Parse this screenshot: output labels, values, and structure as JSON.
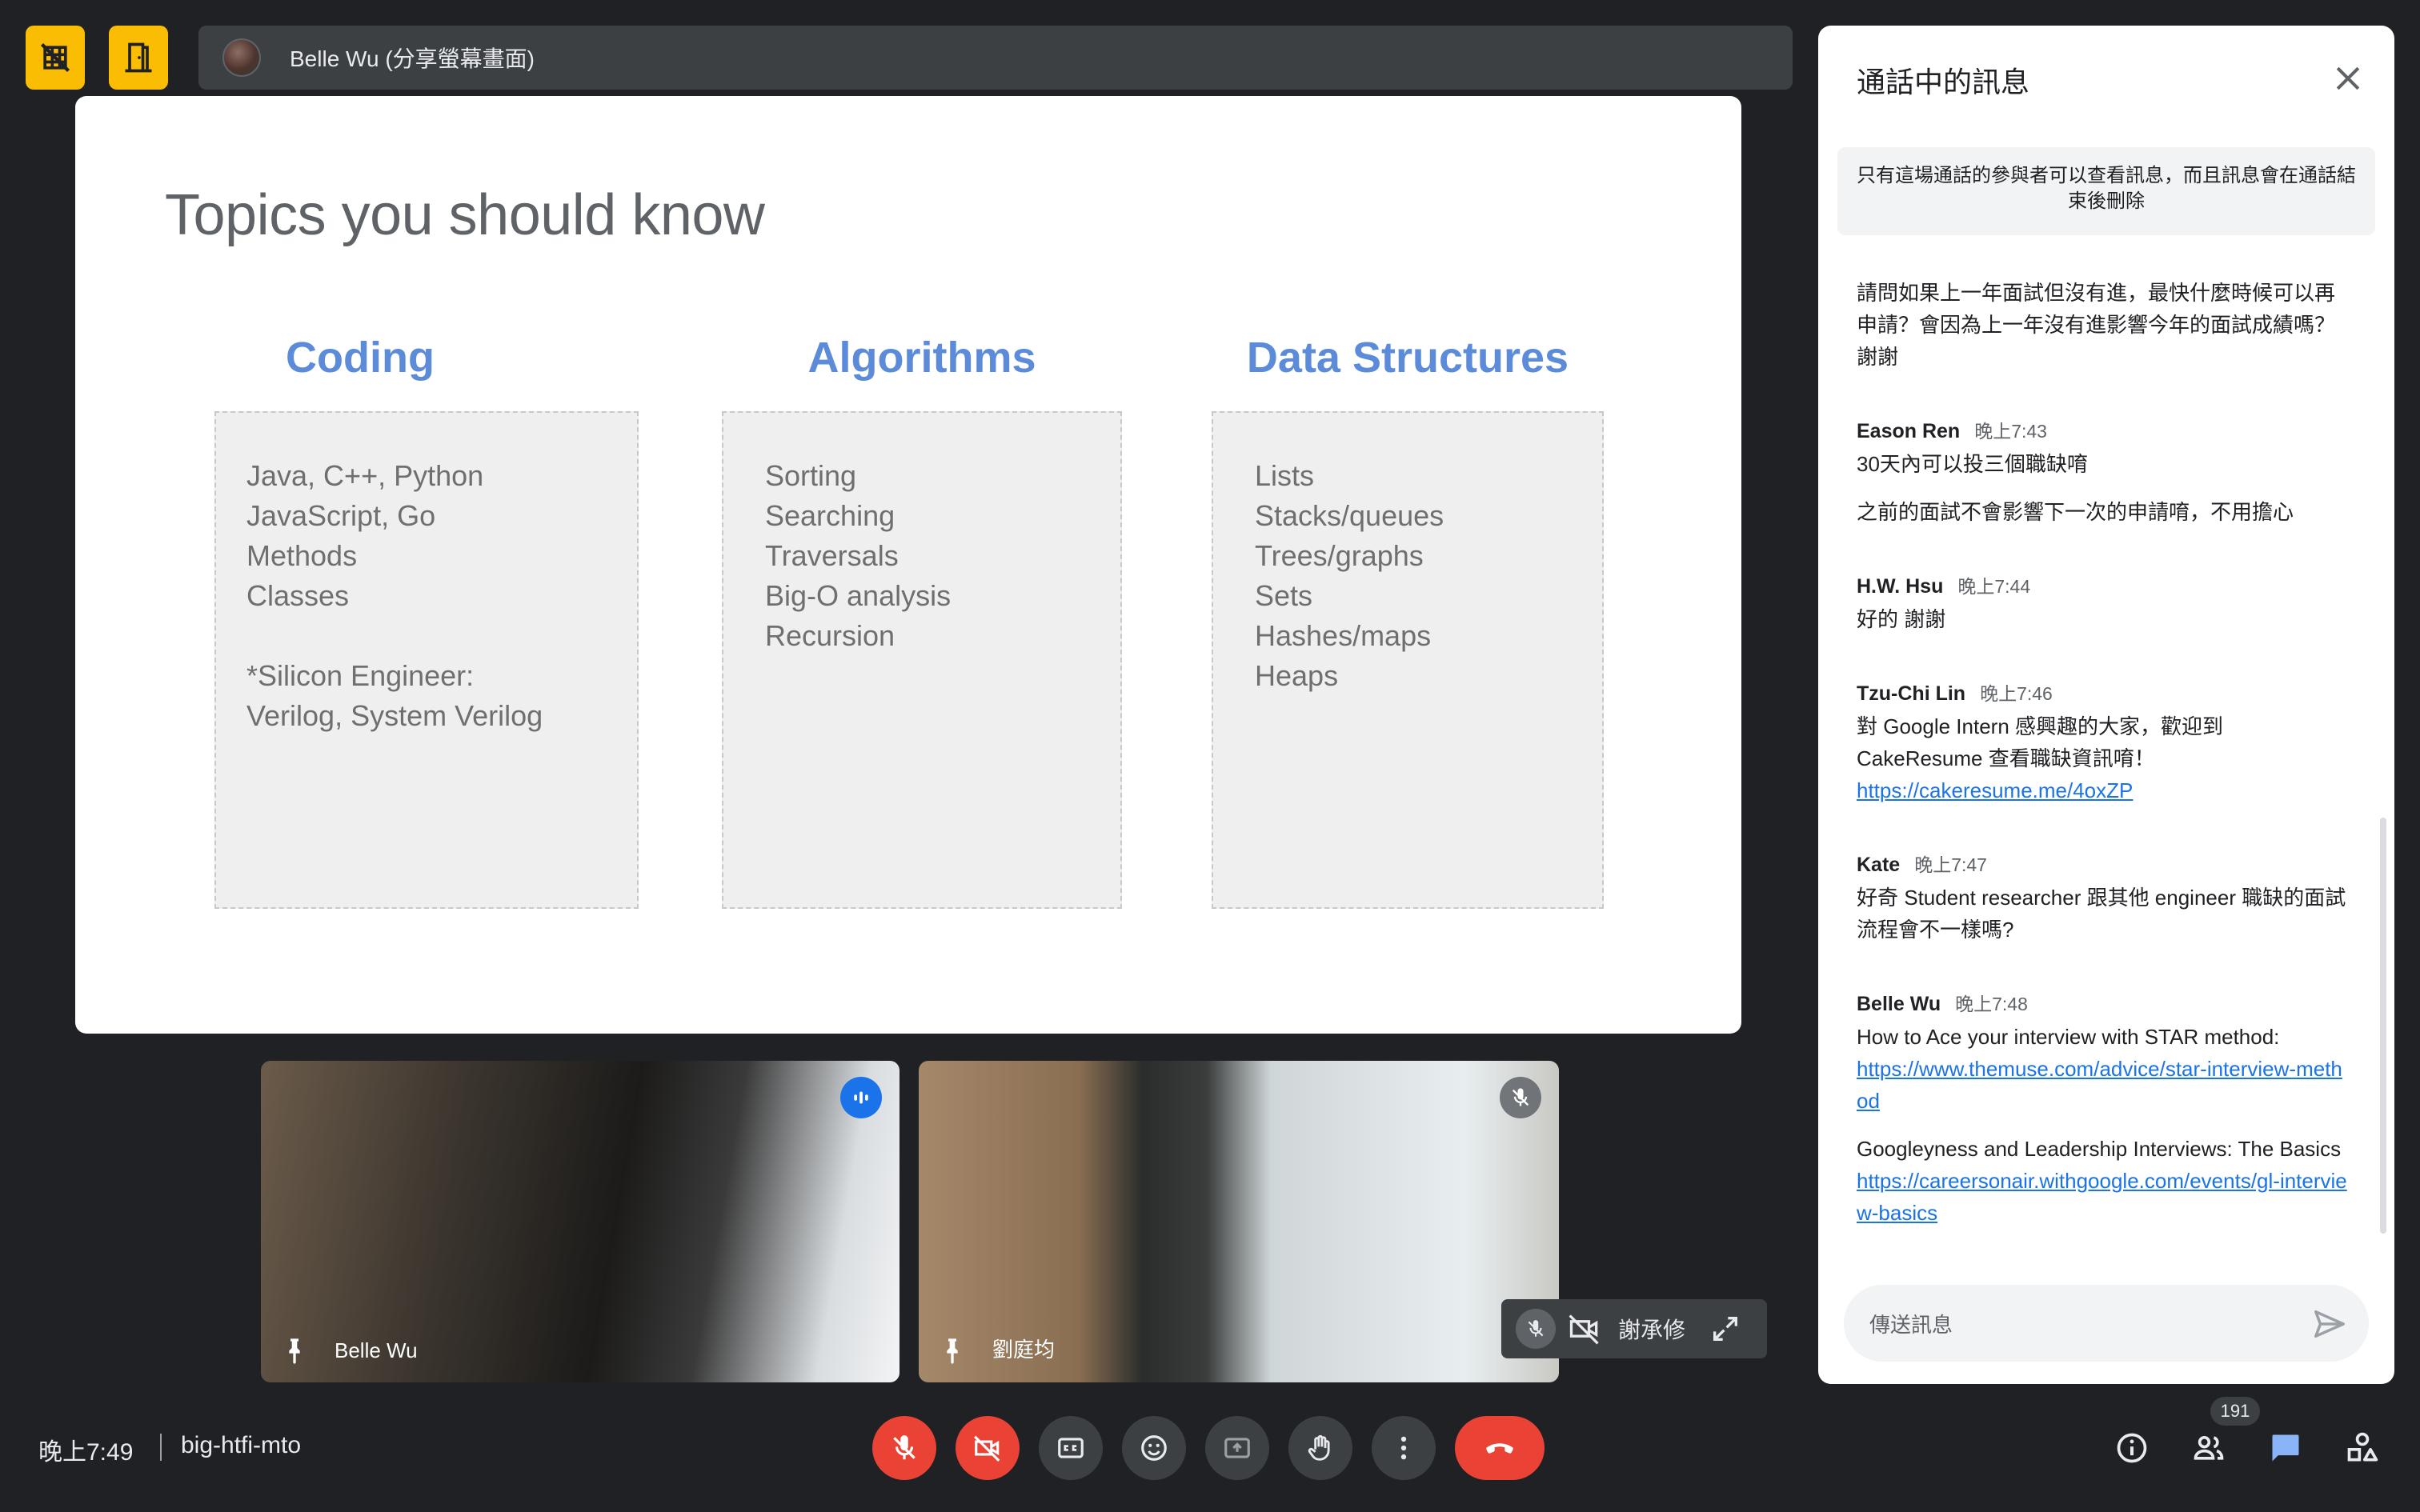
{
  "presenter": {
    "label": "Belle Wu (分享螢幕畫面)"
  },
  "slide": {
    "title": "Topics you should know",
    "columns": [
      {
        "title": "Coding",
        "items": [
          "Java, C++, Python",
          "JavaScript, Go",
          "Methods",
          "Classes",
          "",
          "*Silicon Engineer:",
          "Verilog, System Verilog"
        ]
      },
      {
        "title": "Algorithms",
        "items": [
          "Sorting",
          "Searching",
          "Traversals",
          "Big-O analysis",
          "Recursion"
        ]
      },
      {
        "title": "Data Structures",
        "items": [
          "Lists",
          "Stacks/queues",
          "Trees/graphs",
          "Sets",
          "Hashes/maps",
          "Heaps"
        ]
      }
    ]
  },
  "tiles": [
    {
      "name": "Belle Wu",
      "mic_state": "speaking"
    },
    {
      "name": "劉庭均",
      "mic_state": "muted"
    }
  ],
  "self_view": {
    "name": "謝承修"
  },
  "chat": {
    "title": "通話中的訊息",
    "notice": "只有這場通話的參與者可以查看訊息，而且訊息會在通話結束後刪除",
    "first_message": "請問如果上一年面試但沒有進，最快什麼時候可以再申請？會因為上一年沒有進影響今年的面試成績嗎？謝謝",
    "messages": [
      {
        "sender": "Eason Ren",
        "time": "晚上7:43",
        "texts": [
          "30天內可以投三個職缺唷",
          "之前的面試不會影響下一次的申請唷，不用擔心"
        ]
      },
      {
        "sender": "H.W. Hsu",
        "time": "晚上7:44",
        "texts": [
          "好的 謝謝"
        ]
      },
      {
        "sender": "Tzu-Chi Lin",
        "time": "晚上7:46",
        "texts": [
          "對 Google Intern 感興趣的大家，歡迎到 CakeResume 查看職缺資訊唷！"
        ],
        "link": "https://cakeresume.me/4oxZP"
      },
      {
        "sender": "Kate",
        "time": "晚上7:47",
        "texts": [
          "好奇 Student researcher 跟其他 engineer 職缺的面試流程會不一樣嗎?"
        ]
      },
      {
        "sender": "Belle Wu",
        "time": "晚上7:48",
        "text1": "How to Ace your interview with STAR method:",
        "link1": "https://www.themuse.com/advice/star-interview-method",
        "text2": "Googleyness and Leadership Interviews: The Basics",
        "link2": "https://careersonair.withgoogle.com/events/gl-interview-basics"
      }
    ],
    "input_placeholder": "傳送訊息"
  },
  "bottom_bar": {
    "time": "晚上7:49",
    "meeting_code": "big-htfi-mto",
    "participant_count": "191"
  },
  "colors": {
    "accent_yellow": "#fbbc04",
    "danger_red": "#ea4335",
    "link_blue": "#1a73e8",
    "slide_heading_blue": "#5b8bd9"
  }
}
